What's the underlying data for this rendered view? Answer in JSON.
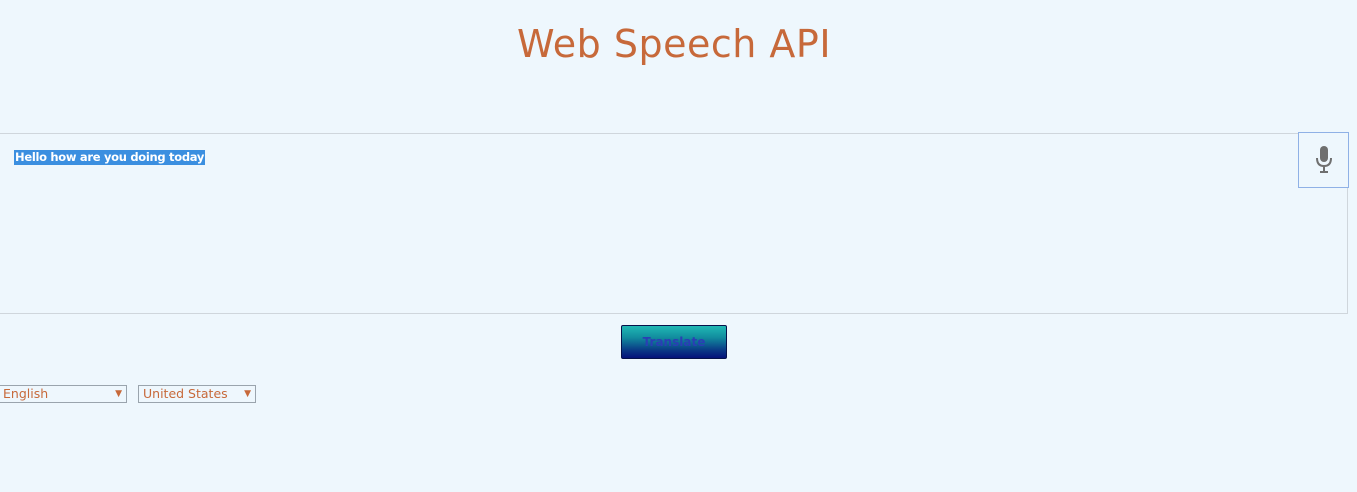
{
  "page": {
    "title": "Web Speech API"
  },
  "transcript": {
    "text": "Hello how are you doing today"
  },
  "mic": {
    "icon": "microphone-icon"
  },
  "translate": {
    "label": "Translate"
  },
  "language_select": {
    "selected": "English"
  },
  "dialect_select": {
    "selected": "United States"
  },
  "colors": {
    "background": "#eef7fd",
    "title": "#c7693a",
    "selection": "#3b8fe0",
    "mic_border": "#8fb1e6"
  }
}
